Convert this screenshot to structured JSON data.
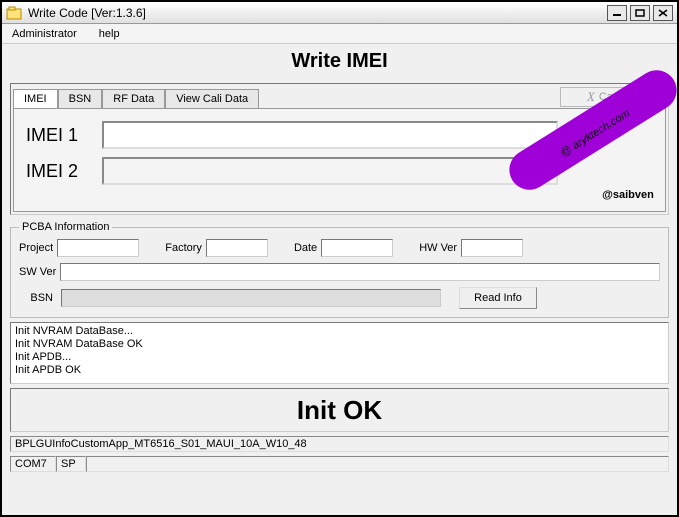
{
  "window": {
    "title": "Write Code [Ver:1.3.6]"
  },
  "menu": {
    "admin": "Administrator",
    "help": "help"
  },
  "page_title": "Write IMEI",
  "tabs": {
    "imei": "IMEI",
    "bsn": "BSN",
    "rfdata": "RF Data",
    "viewcali": "View Cali Data",
    "cancel": "Cancel"
  },
  "imei": {
    "label1": "IMEI 1",
    "value1": "",
    "label2": "IMEI 2",
    "value2": ""
  },
  "watermark": {
    "line1": "@ aryktech.com",
    "line2": "@saibven"
  },
  "pcba": {
    "legend": "PCBA Information",
    "project_lbl": "Project",
    "project_val": "",
    "factory_lbl": "Factory",
    "factory_val": "",
    "date_lbl": "Date",
    "date_val": "",
    "hwver_lbl": "HW Ver",
    "hwver_val": "",
    "swver_lbl": "SW Ver",
    "swver_val": "",
    "bsn_lbl": "BSN",
    "bsn_val": "",
    "readinfo": "Read Info"
  },
  "log": {
    "l1": "Init NVRAM DataBase...",
    "l2": "Init NVRAM DataBase OK",
    "l3": "Init APDB...",
    "l4": "Init APDB OK"
  },
  "big_status": "Init OK",
  "statusbar": {
    "file": "BPLGUInfoCustomApp_MT6516_S01_MAUI_10A_W10_48",
    "port": "COM7",
    "mode": "SP"
  }
}
